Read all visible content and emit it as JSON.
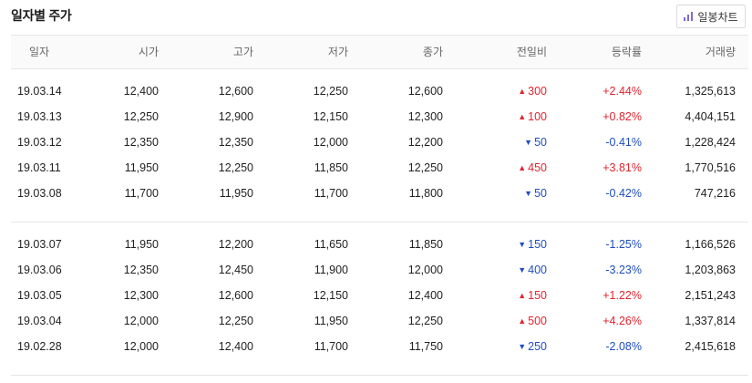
{
  "header": {
    "title": "일자별 주가",
    "chart_button_label": "일봉차트"
  },
  "table": {
    "columns": [
      "일자",
      "시가",
      "고가",
      "저가",
      "종가",
      "전일비",
      "등락률",
      "거래량"
    ],
    "groups": [
      [
        {
          "date": "19.03.14",
          "open": "12,400",
          "high": "12,600",
          "low": "12,250",
          "close": "12,600",
          "dir": "up",
          "change": "300",
          "rate": "+2.44%",
          "volume": "1,325,613"
        },
        {
          "date": "19.03.13",
          "open": "12,250",
          "high": "12,900",
          "low": "12,150",
          "close": "12,300",
          "dir": "up",
          "change": "100",
          "rate": "+0.82%",
          "volume": "4,404,151"
        },
        {
          "date": "19.03.12",
          "open": "12,350",
          "high": "12,350",
          "low": "12,000",
          "close": "12,200",
          "dir": "down",
          "change": "50",
          "rate": "-0.41%",
          "volume": "1,228,424"
        },
        {
          "date": "19.03.11",
          "open": "11,950",
          "high": "12,250",
          "low": "11,850",
          "close": "12,250",
          "dir": "up",
          "change": "450",
          "rate": "+3.81%",
          "volume": "1,770,516"
        },
        {
          "date": "19.03.08",
          "open": "11,700",
          "high": "11,950",
          "low": "11,700",
          "close": "11,800",
          "dir": "down",
          "change": "50",
          "rate": "-0.42%",
          "volume": "747,216"
        }
      ],
      [
        {
          "date": "19.03.07",
          "open": "11,950",
          "high": "12,200",
          "low": "11,650",
          "close": "11,850",
          "dir": "down",
          "change": "150",
          "rate": "-1.25%",
          "volume": "1,166,526"
        },
        {
          "date": "19.03.06",
          "open": "12,350",
          "high": "12,450",
          "low": "11,900",
          "close": "12,000",
          "dir": "down",
          "change": "400",
          "rate": "-3.23%",
          "volume": "1,203,863"
        },
        {
          "date": "19.03.05",
          "open": "12,300",
          "high": "12,600",
          "low": "12,150",
          "close": "12,400",
          "dir": "up",
          "change": "150",
          "rate": "+1.22%",
          "volume": "2,151,243"
        },
        {
          "date": "19.03.04",
          "open": "12,000",
          "high": "12,250",
          "low": "11,950",
          "close": "12,250",
          "dir": "up",
          "change": "500",
          "rate": "+4.26%",
          "volume": "1,337,814"
        },
        {
          "date": "19.02.28",
          "open": "12,000",
          "high": "12,400",
          "low": "11,700",
          "close": "11,750",
          "dir": "down",
          "change": "250",
          "rate": "-2.08%",
          "volume": "2,415,618"
        }
      ]
    ]
  },
  "colors": {
    "up": "#e0242f",
    "down": "#1f4ec0",
    "icon_accent": "#7a6cd6"
  },
  "icons": {
    "chart_button": "bar-chart-icon",
    "up": "up-triangle-icon",
    "down": "down-triangle-icon"
  }
}
